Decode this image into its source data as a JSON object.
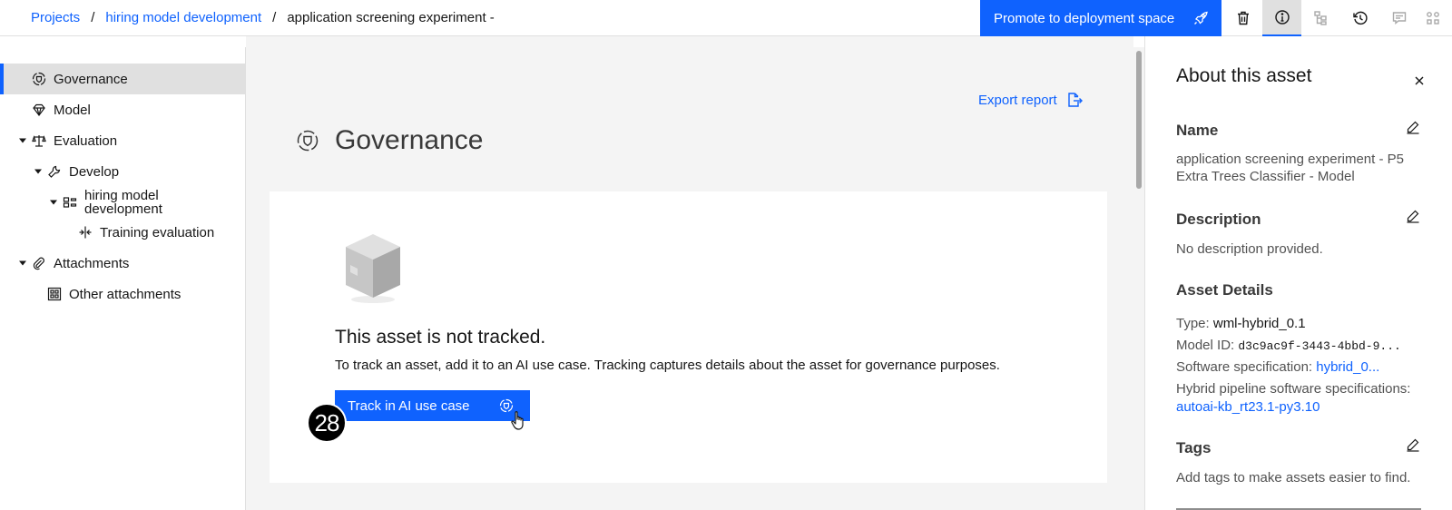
{
  "breadcrumb": {
    "items": [
      "Projects",
      "hiring model development"
    ],
    "separator": "/",
    "current": "application screening experiment -"
  },
  "toolbar": {
    "promote_label": "Promote to deployment space",
    "icons": [
      "trash-icon",
      "info-icon",
      "lineage-icon",
      "history-icon",
      "chat-icon",
      "relationships-icon"
    ]
  },
  "sidebar": {
    "items": [
      {
        "label": "Governance",
        "icon": "governance-icon",
        "selected": true
      },
      {
        "label": "Model",
        "icon": "diamond-icon"
      },
      {
        "label": "Evaluation",
        "icon": "scale-icon",
        "expanded": true
      },
      {
        "label": "Develop",
        "icon": "wrench-icon",
        "expanded": true
      },
      {
        "label": "hiring model development",
        "icon": "project-icon",
        "expanded": true
      },
      {
        "label": "Training evaluation",
        "icon": "split-icon"
      },
      {
        "label": "Attachments",
        "icon": "paperclip-icon",
        "expanded": true
      },
      {
        "label": "Other attachments",
        "icon": "grid-icon"
      }
    ]
  },
  "main": {
    "export_label": "Export report",
    "title": "Governance",
    "not_tracked_title": "This asset is not tracked.",
    "not_tracked_desc": "To track an asset, add it to an AI use case. Tracking captures details about the asset for governance purposes.",
    "track_button": "Track in AI use case",
    "step_badge": "28"
  },
  "panel": {
    "title": "About this asset",
    "name_heading": "Name",
    "name_value_line1": "application screening experiment - P5",
    "name_value_line2": "Extra Trees Classifier - Model",
    "description_heading": "Description",
    "description_value": "No description provided.",
    "details_heading": "Asset Details",
    "type_label": "Type:",
    "type_value": "wml-hybrid_0.1",
    "model_id_label": "Model ID:",
    "model_id_value": "d3c9ac9f-3443-4bbd-9...",
    "software_spec_label": "Software specification:",
    "software_spec_value": "hybrid_0...",
    "hybrid_spec_label": "Hybrid pipeline software specifications:",
    "hybrid_spec_value": "autoai-kb_rt23.1-py3.10",
    "tags_heading": "Tags",
    "tags_value": "Add tags to make assets easier to find."
  },
  "colors": {
    "accent": "#0f62fe",
    "selected_bg": "#e0e0e0",
    "main_bg": "#f4f4f4"
  }
}
